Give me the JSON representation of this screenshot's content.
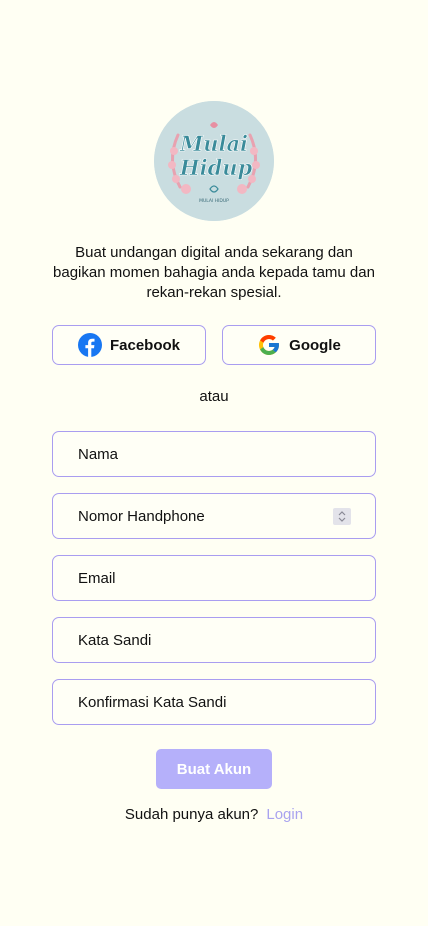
{
  "logo": {
    "text_line1": "Mulai",
    "text_line2": "Hidup",
    "subtext": "MULAI HIDUP"
  },
  "intro": "Buat undangan digital anda sekarang dan bagikan momen bahagia anda kepada tamu dan rekan-rekan spesial.",
  "social": {
    "facebook_label": "Facebook",
    "facebook_icon": "facebook-icon",
    "google_label": "Google",
    "google_icon": "google-icon"
  },
  "divider": "atau",
  "form": {
    "name_placeholder": "Nama",
    "phone_placeholder": "Nomor Handphone",
    "email_placeholder": "Email",
    "password_placeholder": "Kata Sandi",
    "confirm_placeholder": "Konfirmasi Kata Sandi",
    "submit_label": "Buat Akun"
  },
  "footer": {
    "prompt": "Sudah punya akun?",
    "login_label": "Login"
  },
  "colors": {
    "background": "#fffff3",
    "border": "#a99df0",
    "button": "#b5b0fa",
    "link": "#a9a3ef",
    "logo_bg": "#c9dde0"
  }
}
